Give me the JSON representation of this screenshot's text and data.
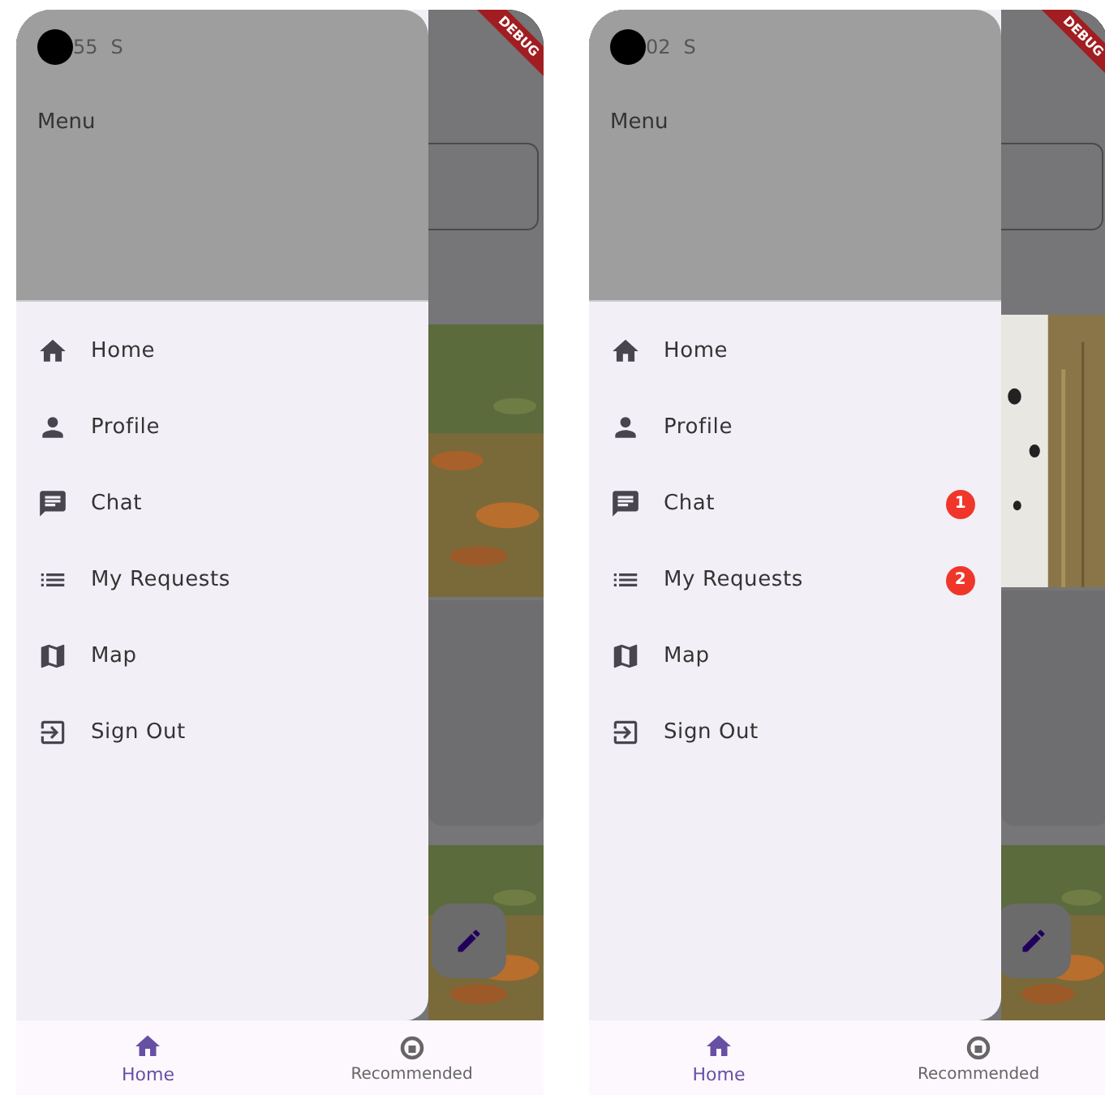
{
  "phones": [
    {
      "status_bar": {
        "time": "55",
        "sim_icon": "S"
      },
      "debug_banner": "DEBUG",
      "drawer": {
        "title": "Menu",
        "items": [
          {
            "label": "Home"
          },
          {
            "label": "Profile"
          },
          {
            "label": "Chat"
          },
          {
            "label": "My Requests"
          },
          {
            "label": "Map"
          },
          {
            "label": "Sign Out"
          }
        ]
      },
      "bottom_nav": [
        {
          "label": "Home",
          "selected": true
        },
        {
          "label": "Recommended",
          "selected": false
        }
      ]
    },
    {
      "status_bar": {
        "time": "02",
        "sim_icon": "S"
      },
      "debug_banner": "DEBUG",
      "drawer": {
        "title": "Menu",
        "items": [
          {
            "label": "Home"
          },
          {
            "label": "Profile"
          },
          {
            "label": "Chat",
            "badge": "1"
          },
          {
            "label": "My Requests",
            "badge": "2"
          },
          {
            "label": "Map"
          },
          {
            "label": "Sign Out"
          }
        ]
      },
      "bottom_nav": [
        {
          "label": "Home",
          "selected": true
        },
        {
          "label": "Recommended",
          "selected": false
        }
      ]
    }
  ]
}
